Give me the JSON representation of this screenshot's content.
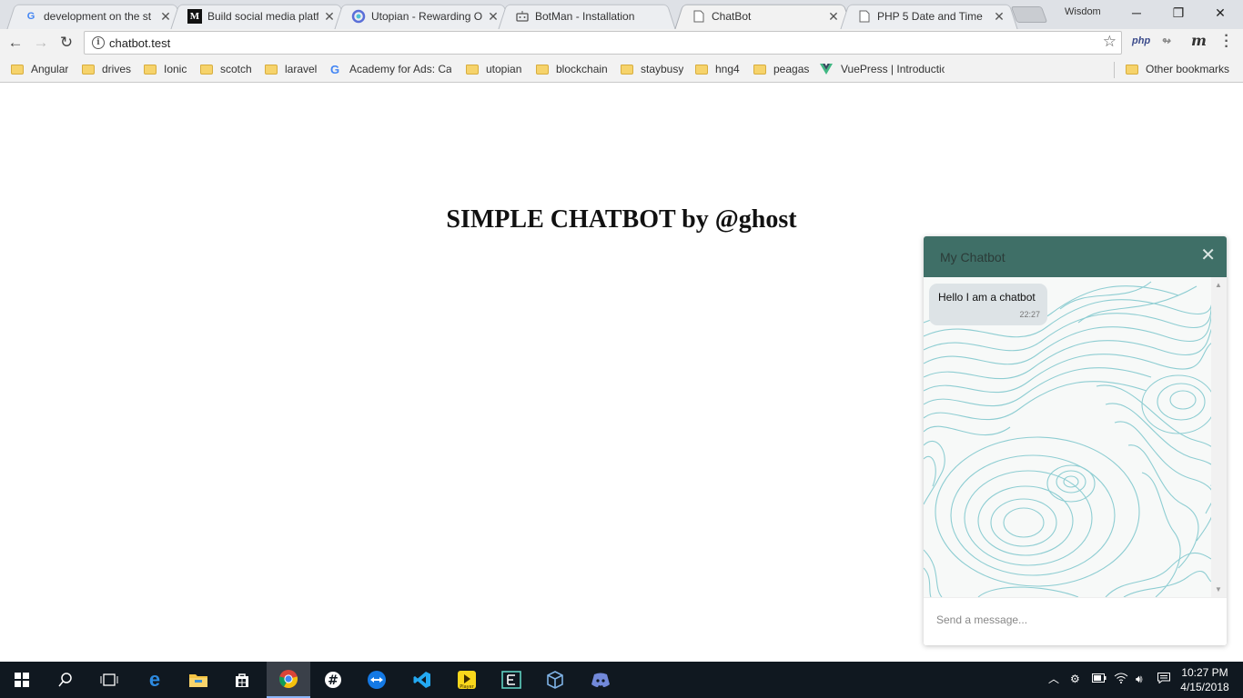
{
  "browser": {
    "tabs": [
      {
        "title": "development on the st",
        "favicon": "google-g-icon"
      },
      {
        "title": "Build social media platf",
        "favicon": "medium-m-icon"
      },
      {
        "title": "Utopian - Rewarding O",
        "favicon": "utopian-icon"
      },
      {
        "title": "BotMan - Installation",
        "favicon": "botman-icon"
      },
      {
        "title": "ChatBot",
        "favicon": "page-icon",
        "active": true
      },
      {
        "title": "PHP 5 Date and Time",
        "favicon": "page-icon"
      }
    ],
    "profile_name": "Wisdom",
    "url": "chatbot.test",
    "extensions": [
      "php",
      "m"
    ],
    "bookmarks": [
      {
        "label": "Angular",
        "icon": "folder-icon"
      },
      {
        "label": "drives",
        "icon": "folder-icon"
      },
      {
        "label": "Ionic",
        "icon": "folder-icon"
      },
      {
        "label": "scotch",
        "icon": "folder-icon"
      },
      {
        "label": "laravel",
        "icon": "folder-icon"
      },
      {
        "label": "Academy for Ads: Cat",
        "icon": "google-g-icon"
      },
      {
        "label": "utopian",
        "icon": "folder-icon"
      },
      {
        "label": "blockchain",
        "icon": "folder-icon"
      },
      {
        "label": "staybusy",
        "icon": "folder-icon"
      },
      {
        "label": "hng4",
        "icon": "folder-icon"
      },
      {
        "label": "peagas",
        "icon": "folder-icon"
      },
      {
        "label": "VuePress | Introductio",
        "icon": "vue-icon"
      }
    ],
    "other_bookmarks": "Other bookmarks"
  },
  "page": {
    "title": "SIMPLE CHATBOT by @ghost"
  },
  "chat": {
    "title": "My Chatbot",
    "messages": [
      {
        "text": "Hello I am a chatbot",
        "time": "22:27"
      }
    ],
    "input_placeholder": "Send a message...",
    "header_color": "#3f6f67",
    "pattern_color": "#7cc6cc"
  },
  "taskbar": {
    "time": "10:27 PM",
    "date": "4/15/2018"
  }
}
